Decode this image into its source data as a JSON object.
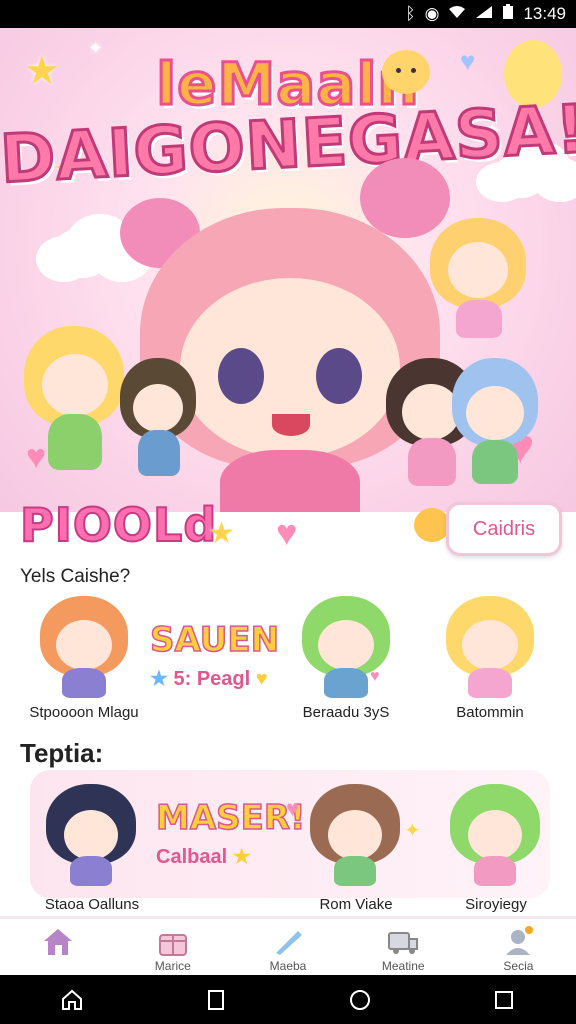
{
  "status_bar": {
    "time": "13:49",
    "icons": [
      "bluetooth-icon",
      "alarm-icon",
      "wifi-icon",
      "signal-icon",
      "battery-icon"
    ]
  },
  "hero": {
    "title_line1": "leMaaln",
    "title_line2": "DAIGONEGASA!"
  },
  "welcome": {
    "title": "PIOOLd",
    "cards_button": "Caidris"
  },
  "section1": {
    "label": "Yels Caishe?",
    "items": [
      {
        "caption": "Stpoooon Mlagu"
      },
      {
        "caption": "Beraadu 3yS"
      },
      {
        "caption": "Batommin"
      }
    ],
    "promo": {
      "big": "SAUEN",
      "small": "5: Peagl"
    }
  },
  "section2": {
    "label": "Teptia:",
    "items": [
      {
        "caption": "Staoa Oalluns"
      },
      {
        "caption": "Rom Viake"
      },
      {
        "caption": "Siroyiegy"
      }
    ],
    "promo": {
      "big": "MASER!",
      "small": "Calbaal"
    }
  },
  "tabbar": {
    "tabs": [
      {
        "label": "",
        "icon": "home-icon"
      },
      {
        "label": "Marice",
        "icon": "gift-icon"
      },
      {
        "label": "Maeba",
        "icon": "brush-icon"
      },
      {
        "label": "Meatine",
        "icon": "truck-icon"
      },
      {
        "label": "Secia",
        "icon": "profile-icon"
      }
    ]
  },
  "colors": {
    "accent": "#e2578e",
    "hero_bg": "#fbd3e8",
    "title_yellow": "#ffcf3a"
  }
}
